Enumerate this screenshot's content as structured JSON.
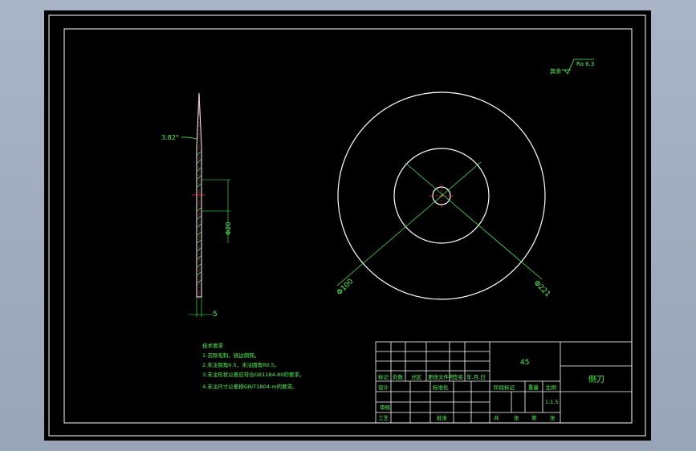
{
  "drawing": {
    "roughness_label": "其余",
    "roughness_value": "Ra 6.3",
    "angle_dimension": "3.82°",
    "side_dim_diameter": "Φ20",
    "thickness_dimension": "5",
    "diameter_100": "Φ100",
    "diameter_221": "Φ221"
  },
  "notes": {
    "title": "技术要求",
    "items": [
      "1.去除毛刺，锐边倒钝。",
      "2.未注倒角0.5，未注圆角R0.5。",
      "3.未注形状公差应符合GB1184-80的要求。",
      "4.未注尺寸公差按GB/T1804-m的要求。"
    ]
  },
  "title_block": {
    "material": "45",
    "part_name": "侧刀",
    "header_labels": [
      "标记",
      "处数",
      "分区",
      "更改文件号",
      "签名",
      "年.月.日"
    ],
    "row_design": "设计",
    "row_standard": "标准化",
    "row_review": "审核",
    "row_process": "工艺",
    "row_approve": "批准",
    "stage_mark": "阶段标记",
    "weight": "重量",
    "scale": "比例",
    "scale_value": "1:1.5",
    "sheet_info": [
      "共",
      "张",
      "第",
      "张"
    ]
  }
}
